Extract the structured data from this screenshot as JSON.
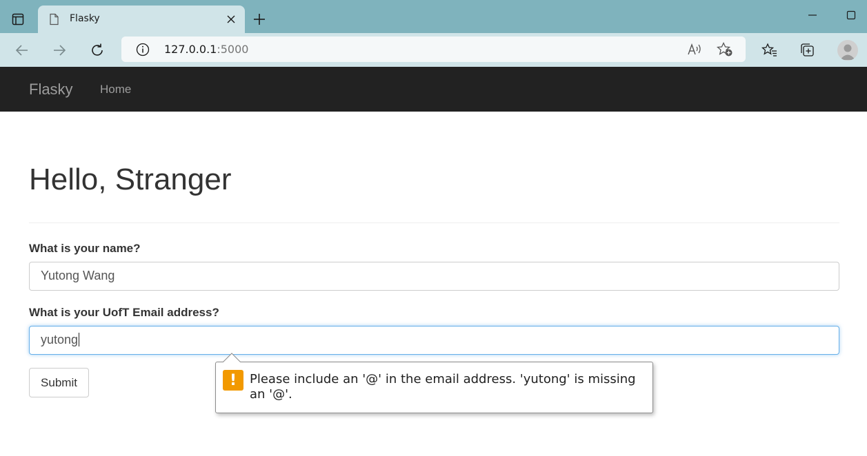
{
  "browser": {
    "tab": {
      "title": "Flasky"
    },
    "url": {
      "host": "127.0.0.1",
      "port": ":5000"
    }
  },
  "navbar": {
    "brand": "Flasky",
    "links": [
      {
        "label": "Home"
      }
    ]
  },
  "page": {
    "heading": "Hello, Stranger",
    "form": {
      "name_label": "What is your name?",
      "name_value": "Yutong Wang",
      "email_label": "What is your UofT Email address?",
      "email_value": "yutong",
      "submit_label": "Submit"
    },
    "validation_tooltip": {
      "icon": "warning-icon",
      "message": "Please include an '@' in the email address. 'yutong' is missing an '@'."
    }
  },
  "colors": {
    "tabstrip": "#7fb3bd",
    "toolbar": "#d0e4e8",
    "navbar": "#222222",
    "focus": "#66afe9",
    "warning": "#f29900"
  }
}
